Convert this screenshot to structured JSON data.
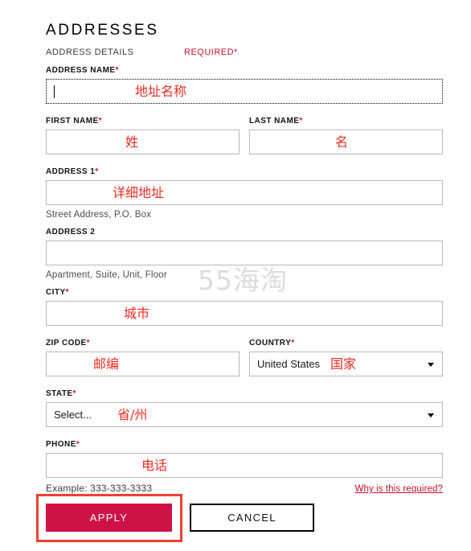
{
  "page": {
    "title": "ADDRESSES",
    "subhead": "ADDRESS DETAILS",
    "required_note": "REQUIRED*",
    "watermark": "55海淘",
    "accent_color": "#ce1246",
    "annotation_color": "#ee2b22",
    "highlight_color": "#f0402f"
  },
  "fields": {
    "address_name": {
      "label": "ADDRESS NAME",
      "required_mark": "*",
      "value": "",
      "annotation": "地址名称",
      "focused": true
    },
    "first_name": {
      "label": "FIRST NAME",
      "required_mark": "*",
      "value": "",
      "annotation": "姓"
    },
    "last_name": {
      "label": "LAST NAME",
      "required_mark": "*",
      "value": "",
      "annotation": "名"
    },
    "address1": {
      "label": "ADDRESS 1",
      "required_mark": "*",
      "value": "",
      "annotation": "详细地址",
      "helper": "Street Address, P.O. Box"
    },
    "address2": {
      "label": "ADDRESS 2",
      "required_mark": "",
      "value": "",
      "annotation": "",
      "helper": "Apartment, Suite, Unit, Floor"
    },
    "city": {
      "label": "CITY",
      "required_mark": "*",
      "value": "",
      "annotation": "城市"
    },
    "zip_code": {
      "label": "ZIP CODE",
      "required_mark": "*",
      "value": "",
      "annotation": "邮编"
    },
    "country": {
      "label": "COUNTRY",
      "required_mark": "*",
      "value": "United States",
      "annotation": "国家",
      "arrow_icon": "chevron-down-icon"
    },
    "state": {
      "label": "STATE",
      "required_mark": "*",
      "value": "Select...",
      "annotation": "省/州",
      "arrow_icon": "chevron-down-icon"
    },
    "phone": {
      "label": "PHONE",
      "required_mark": "*",
      "value": "",
      "annotation": "电话",
      "example": "Example: 333-333-3333",
      "why_link": "Why is this required?"
    }
  },
  "actions": {
    "apply_label": "APPLY",
    "cancel_label": "CANCEL"
  }
}
